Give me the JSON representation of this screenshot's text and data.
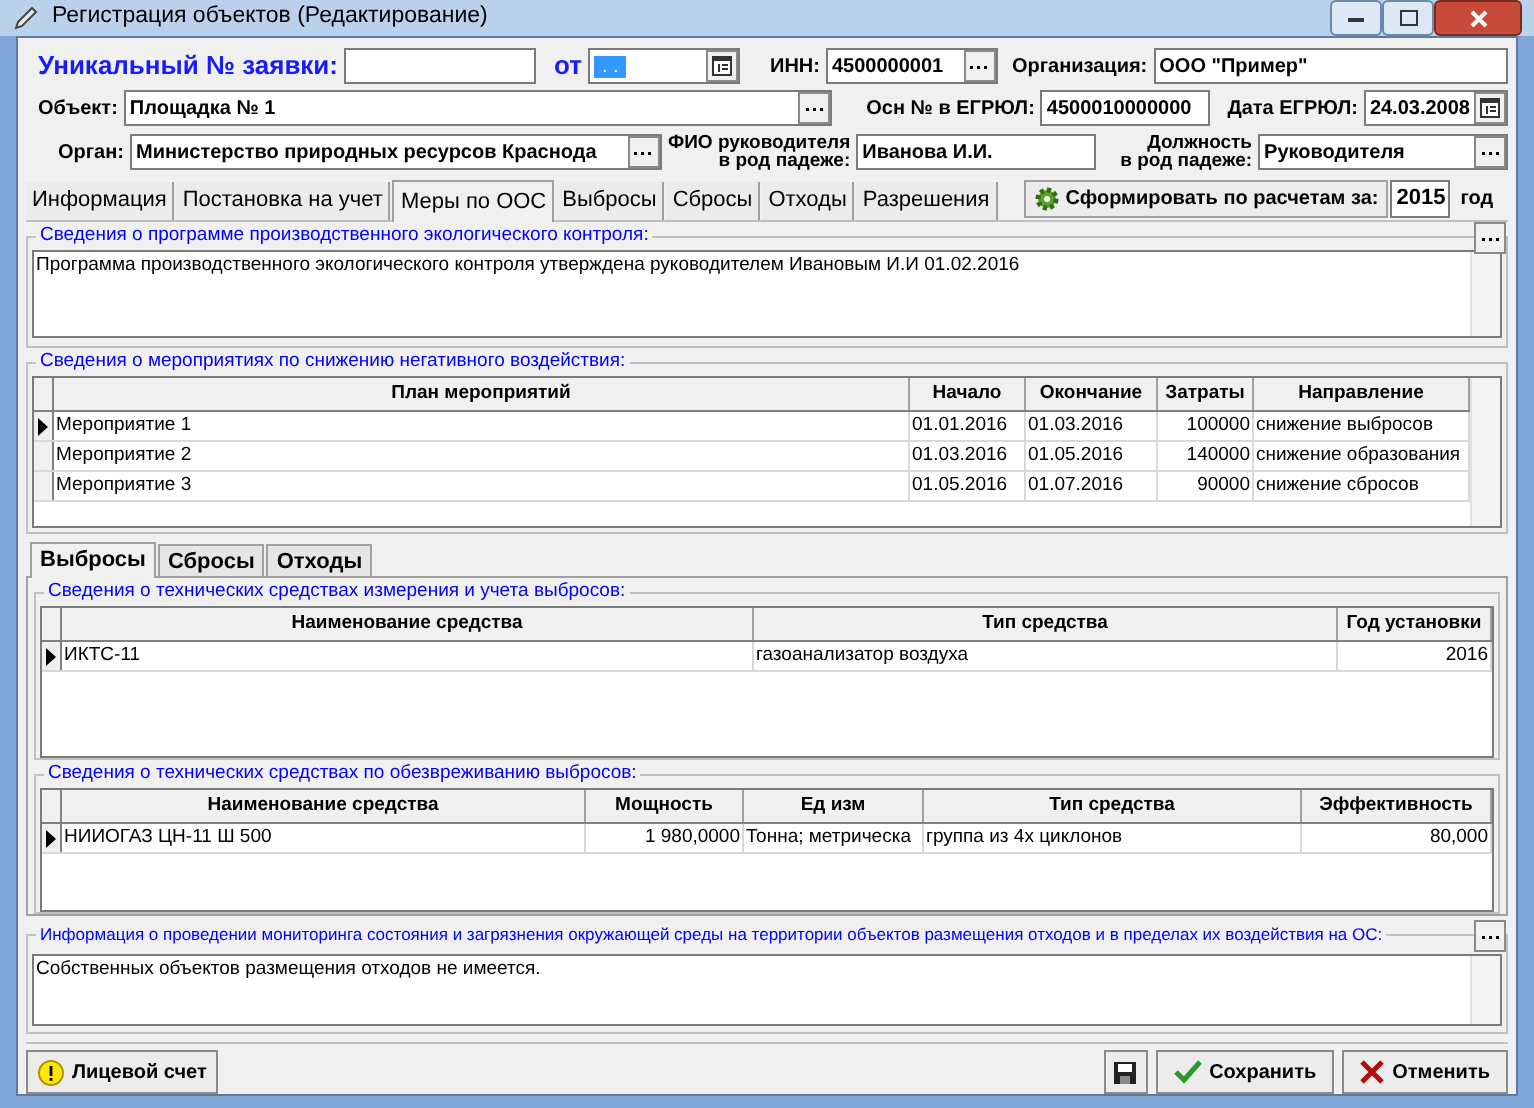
{
  "window": {
    "title": "Регистрация объектов (Редактирование)"
  },
  "header": {
    "request_label": "Уникальный № заявки:",
    "date_label": "от",
    "date_value": ". .",
    "inn_label": "ИНН:",
    "inn_value": "4500000001",
    "org_label": "Организация:",
    "org_value": "ООО \"Пример\"",
    "object_label": "Объект:",
    "object_value": "Площадка № 1",
    "ogrn_label": "Осн № в ЕГРЮЛ:",
    "ogrn_value": "4500010000000",
    "egrul_date_label": "Дата ЕГРЮЛ:",
    "egrul_date_value": "24.03.2008",
    "organ_label": "Орган:",
    "organ_value": "Министерство природных ресурсов Краснода",
    "head_label": [
      "ФИО руководителя",
      "в род падеже:"
    ],
    "head_value": "Иванова И.И.",
    "position_label": [
      "Должность",
      "в род падеже:"
    ],
    "position_value": "Руководителя"
  },
  "tabs": [
    {
      "label": "Информация",
      "selected": false
    },
    {
      "label": "Постановка на учет",
      "selected": false
    },
    {
      "label": "Меры по ООС",
      "selected": true
    },
    {
      "label": "Выбросы",
      "selected": false
    },
    {
      "label": "Сбросы",
      "selected": false
    },
    {
      "label": "Отходы",
      "selected": false
    },
    {
      "label": "Разрешения",
      "selected": false
    }
  ],
  "form_button": {
    "label": "Сформировать по расчетам за:",
    "year_value": "2015",
    "year_unit": "год"
  },
  "program": {
    "legend": "Сведения о программе производственного экологического контроля:",
    "text": "Программа производственного экологического контроля утверждена руководителем Ивановым И.И 01.02.2016"
  },
  "measures": {
    "legend": "Сведения о мероприятиях по снижению негативного воздействия:",
    "columns": [
      "План мероприятий",
      "Начало",
      "Окончание",
      "Затраты",
      "Направление"
    ],
    "rows": [
      {
        "cells": [
          "Мероприятие 1",
          "01.01.2016",
          "01.03.2016",
          "100000",
          "снижение выбросов"
        ],
        "selected": true
      },
      {
        "cells": [
          "Мероприятие 2",
          "01.03.2016",
          "01.05.2016",
          "140000",
          "снижение образования"
        ],
        "selected": false
      },
      {
        "cells": [
          "Мероприятие 3",
          "01.05.2016",
          "01.07.2016",
          "90000",
          "снижение сбросов"
        ],
        "selected": false
      }
    ]
  },
  "subtabs": [
    {
      "label": "Выбросы",
      "selected": true
    },
    {
      "label": "Сбросы",
      "selected": false
    },
    {
      "label": "Отходы",
      "selected": false
    }
  ],
  "meters": {
    "legend": "Сведения о технических средствах измерения и учета выбросов:",
    "columns": [
      "Наименование средства",
      "Тип средства",
      "Год установки"
    ],
    "rows": [
      {
        "cells": [
          "ИКТС-11",
          "газоанализатор воздуха",
          "2016"
        ],
        "selected": true
      }
    ]
  },
  "neutralization": {
    "legend": "Сведения о технических средствах по обезвреживанию выбросов:",
    "columns": [
      "Наименование средства",
      "Мощность",
      "Ед изм",
      "Тип средства",
      "Эффективность"
    ],
    "rows": [
      {
        "cells": [
          "НИИОГАЗ ЦН-11 Ш 500",
          "1 980,0000",
          "Тонна; метрическа",
          "группа из 4х циклонов",
          "80,000"
        ],
        "selected": true
      }
    ]
  },
  "monitoring": {
    "legend": "Информация о проведении мониторинга состояния и загрязнения окружающей среды на территории объектов размещения отходов и в пределах их воздействия на ОС:",
    "text": "Собственных объектов размещения отходов не имеется."
  },
  "footer": {
    "account_button": "Лицевой счет",
    "save_button": "Сохранить",
    "cancel_button": "Отменить"
  }
}
